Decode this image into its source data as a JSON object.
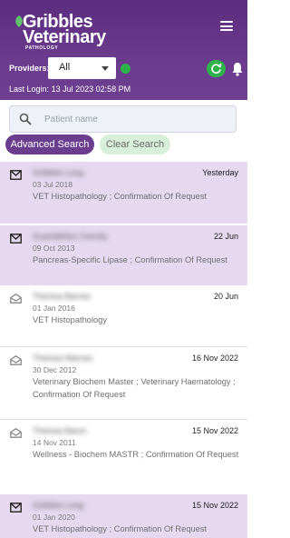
{
  "header": {
    "brand_line1": "Gribbles",
    "brand_line2": "Veterinary",
    "brand_sub": "PATHOLOGY",
    "providers_label": "Providers:",
    "providers_value": "All",
    "last_login_label": "Last Login:",
    "last_login_value": "13 Jul 2023 02:58 PM",
    "status_color": "#2fb24c"
  },
  "search": {
    "placeholder": "Patient name",
    "value": "",
    "advanced_label": "Advanced Search",
    "clear_label": "Clear Search"
  },
  "results": [
    {
      "patient": "Gribbles Long",
      "date": "Yesterday",
      "dob": "03 Jul 2018",
      "tests": "VET Histopathology ; Confirmation Of Request",
      "unread": true
    },
    {
      "patient": "Guardafidox Cremity",
      "date": "22 Jun",
      "dob": "09 Oct 2013",
      "tests": "Pancreas-Specific Lipase ; Confirmation Of Request",
      "unread": true
    },
    {
      "patient": "Theresa Barnes",
      "date": "20 Jun",
      "dob": "01 Jan 2016",
      "tests": "VET Histopathology",
      "unread": false
    },
    {
      "patient": "Theresa Warnes",
      "date": "16 Nov 2022",
      "dob": "30 Dec 2012",
      "tests": "Veterinary Biochem Master ; Veterinary Haematology ; Confirmation Of Request",
      "unread": false
    },
    {
      "patient": "Theresa Baron",
      "date": "15 Nov 2022",
      "dob": "14 Nov 2011",
      "tests": "Wellness - Biochem MASTR ; Confirmation Of Request",
      "unread": false
    },
    {
      "patient": "Gribbles Long",
      "date": "15 Nov 2022",
      "dob": "01 Jan 2020",
      "tests": "VET Histopathology ; Confirmation Of Request",
      "unread": true
    }
  ]
}
